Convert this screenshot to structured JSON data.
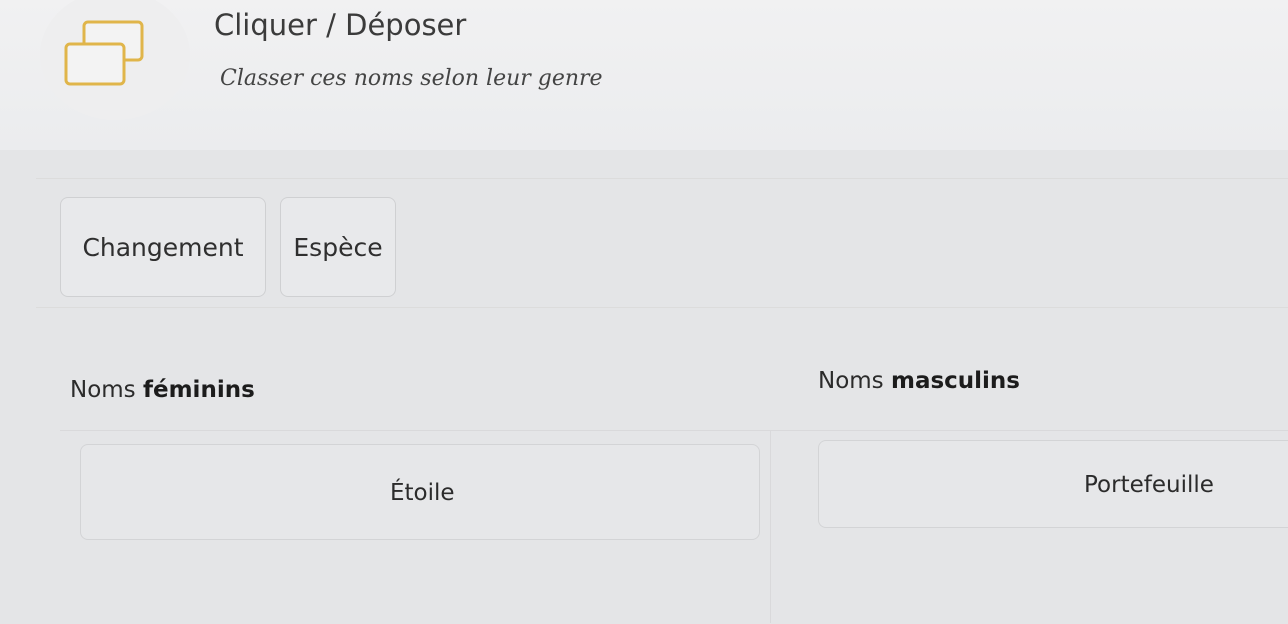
{
  "header": {
    "title": "Cliquer / Déposer",
    "instruction": "Classer ces noms selon leur genre",
    "icon": "drag-drop-windows-icon",
    "icon_color": "#e0b54a"
  },
  "word_bank": {
    "words": [
      "Changement",
      "Espèce"
    ]
  },
  "categories": [
    {
      "label_prefix": "Noms",
      "label_bold": "féminins",
      "placed_word": "Étoile"
    },
    {
      "label_prefix": "Noms",
      "label_bold": "masculins",
      "placed_word": "Portefeuille"
    }
  ]
}
